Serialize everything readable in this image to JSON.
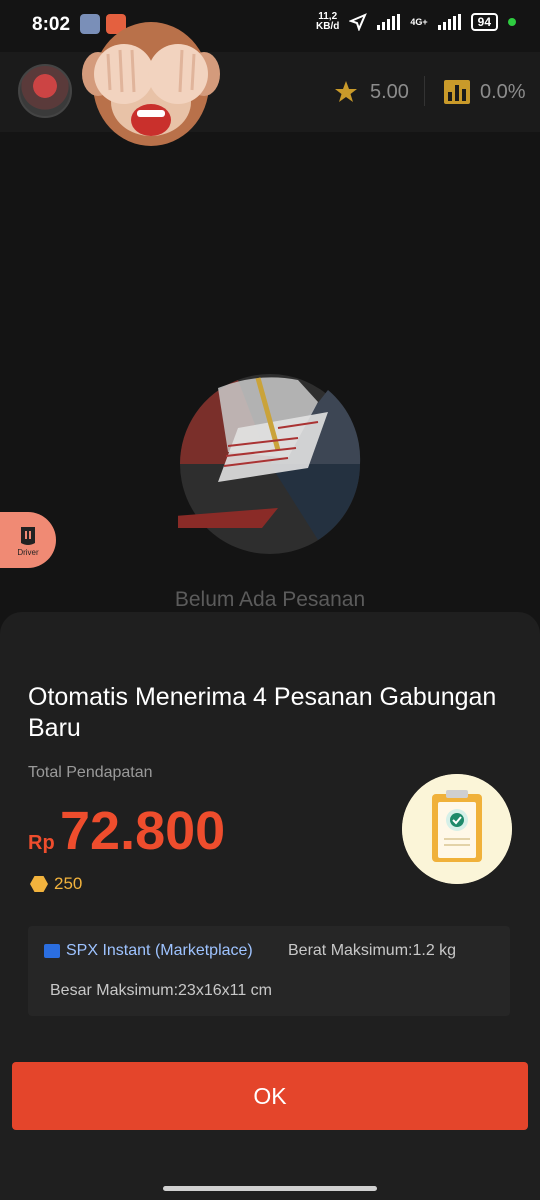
{
  "status_bar": {
    "time": "8:02",
    "speed_top": "11,2",
    "speed_bottom": "KB/d",
    "network": "4G+",
    "battery": "94"
  },
  "header": {
    "rating": "5.00",
    "rate": "0.0%"
  },
  "main": {
    "empty_text": "Belum Ada Pesanan",
    "driver_label": "Driver"
  },
  "sheet": {
    "title": "Otomatis Menerima 4 Pesanan Gabungan Baru",
    "earn_label": "Total Pendapatan",
    "currency": "Rp",
    "amount": "72.800",
    "coins": "250",
    "service": "SPX Instant (Marketplace)",
    "max_weight": "Berat Maksimum:1.2 kg",
    "max_size": "Besar Maksimum:23x16x11 cm",
    "ok_label": "OK"
  },
  "colors": {
    "accent": "#ee4d2d",
    "button": "#e4452b",
    "coin": "#f2b33d",
    "link": "#9ec3ff"
  },
  "icons": [
    "settings-icon",
    "app-icon",
    "location-arrow-icon",
    "signal-icon",
    "battery-icon",
    "star-icon",
    "bar-chart-icon",
    "driver-icon",
    "coin-icon",
    "spx-icon",
    "clipboard-check-icon"
  ]
}
